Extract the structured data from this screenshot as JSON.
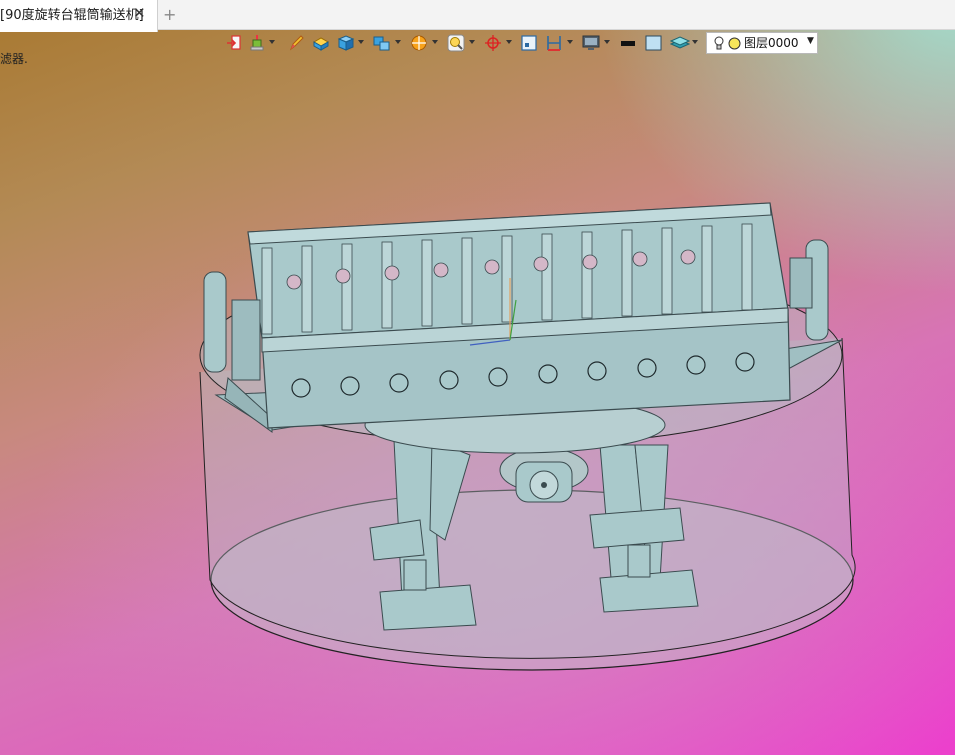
{
  "tabs": [
    {
      "label": "[90度旋转台辊筒输送机]",
      "close": "✕"
    }
  ],
  "new_tab": "+",
  "filter_label": "滤器.",
  "toolbar": {
    "icons": [
      "exit-icon",
      "align-icon",
      "pencil-icon",
      "solid-box-icon",
      "cube-view-icon",
      "assembly-icon",
      "render-sphere-icon",
      "zoom-fit-icon",
      "pivot-icon",
      "frame-icon",
      "dimension-icon",
      "display-mode-icon",
      "line-color-icon",
      "fill-color-icon",
      "layers-icon"
    ],
    "layer_value": "图层0000"
  },
  "colors": {
    "model_fill": "#a9c9cb",
    "model_line": "#3b4b4f",
    "cylinder_fill": "#c5b8c8"
  }
}
